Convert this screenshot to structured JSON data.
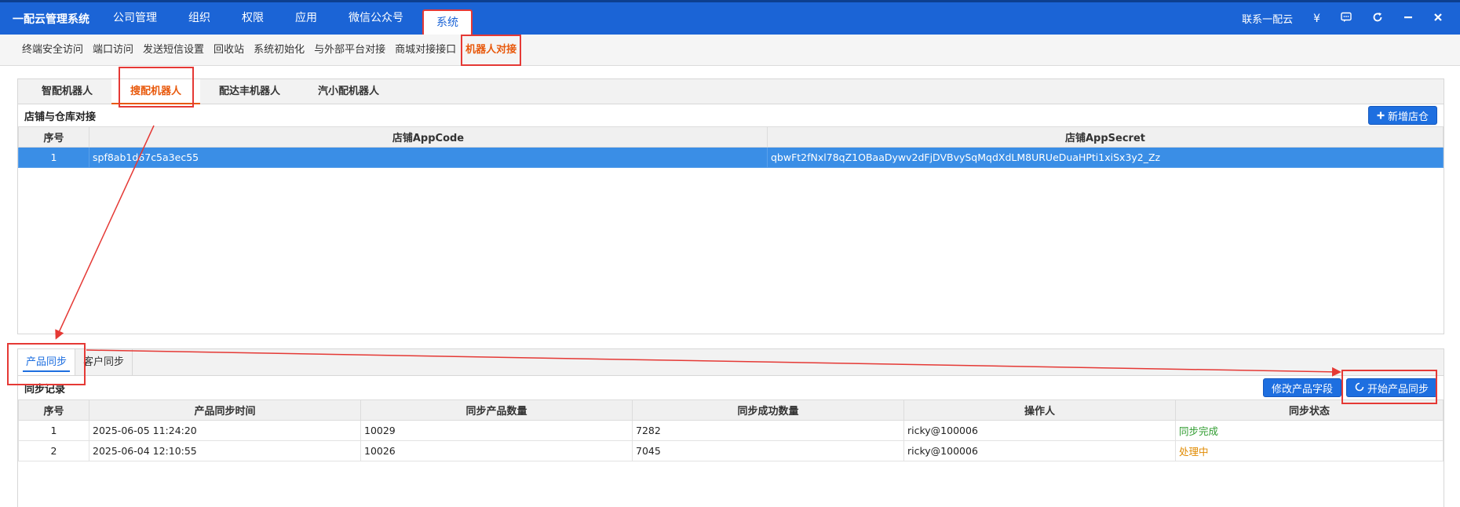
{
  "app": {
    "title": "一配云管理系统"
  },
  "topmenu": [
    "公司管理",
    "组织",
    "权限",
    "应用",
    "微信公众号",
    "系统"
  ],
  "topright": {
    "contact": "联系一配云",
    "yen": "¥"
  },
  "subnav": [
    "终端安全访问",
    "端口访问",
    "发送短信设置",
    "回收站",
    "系统初始化",
    "与外部平台对接",
    "商城对接接口",
    "机器人对接"
  ],
  "robot_tabs": [
    "智配机器人",
    "搜配机器人",
    "配达丰机器人",
    "汽小配机器人"
  ],
  "store": {
    "title": "店铺与仓库对接",
    "add_button": "新增店仓",
    "columns": [
      "序号",
      "店铺AppCode",
      "店铺AppSecret"
    ],
    "rows": [
      {
        "no": "1",
        "code": "spf8ab1d67c5a3ec55",
        "secret": "qbwFt2fNxl78qZ1OBaaDywv2dFjDVBvySqMqdXdLM8URUeDuaHPti1xiSx3y2_Zz"
      }
    ]
  },
  "sync_tabs": [
    "产品同步",
    "客户同步"
  ],
  "sync": {
    "title": "同步记录",
    "edit_button": "修改产品字段",
    "start_button": "开始产品同步",
    "columns": [
      "序号",
      "产品同步时间",
      "同步产品数量",
      "同步成功数量",
      "操作人",
      "同步状态"
    ],
    "rows": [
      {
        "no": "1",
        "time": "2025-06-05 11:24:20",
        "count": "10029",
        "success": "7282",
        "operator": "ricky@100006",
        "status": "同步完成"
      },
      {
        "no": "2",
        "time": "2025-06-04 12:10:55",
        "count": "10026",
        "success": "7045",
        "operator": "ricky@100006",
        "status": "处理中"
      }
    ]
  },
  "colors": {
    "primary": "#1b64d6",
    "accent": "#e8590c",
    "annotation": "#e53935"
  }
}
